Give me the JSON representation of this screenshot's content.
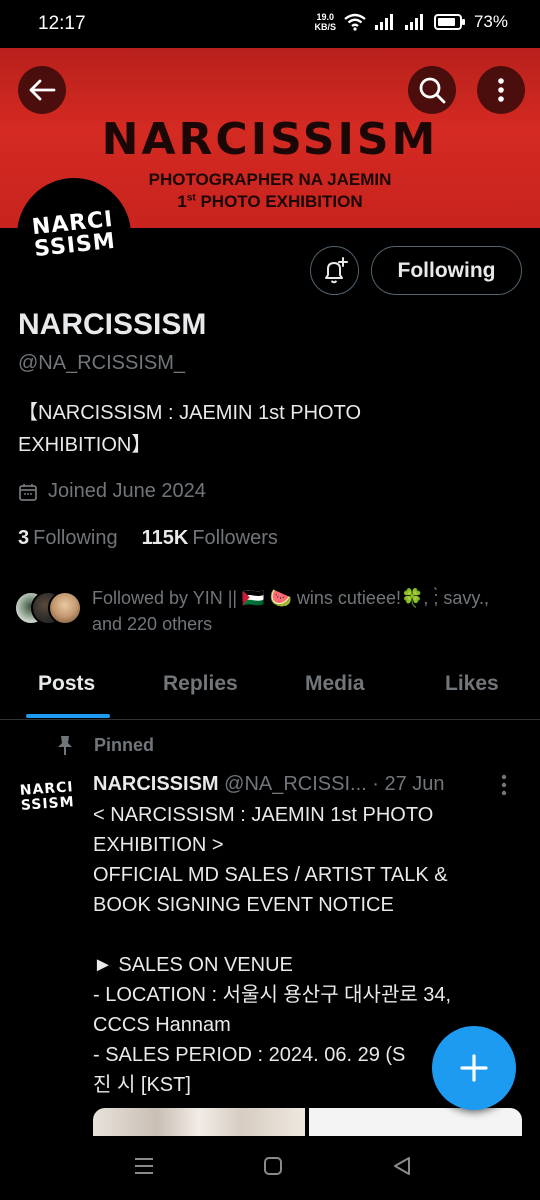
{
  "status": {
    "time": "12:17",
    "net_speed_value": "19.0",
    "net_speed_unit": "KB/S",
    "battery": "73%"
  },
  "banner": {
    "title": "NARCISSISM",
    "subtitle_line1": "PHOTOGRAPHER NA JAEMIN",
    "subtitle_line2_num": "1",
    "subtitle_line2_sup": "st",
    "subtitle_line2_rest": " PHOTO EXHIBITION"
  },
  "profile": {
    "avatar_text_line1": "NARCI",
    "avatar_text_line2": "SSISM",
    "following_button": "Following",
    "display_name": "NARCISSISM",
    "handle": "@NA_RCISSISM_",
    "bio": "【NARCISSISM : JAEMIN 1st PHOTO EXHIBITION】",
    "joined": "Joined June 2024",
    "following_count": "3",
    "following_label": "Following",
    "followers_count": "115K",
    "followers_label": "Followers",
    "followed_by": "Followed by YIN || 🇵🇸 🍉 wins cutieee!🍀, ;̀ savy., and 220 others"
  },
  "tabs": [
    {
      "label": "Posts"
    },
    {
      "label": "Replies"
    },
    {
      "label": "Media"
    },
    {
      "label": "Likes"
    }
  ],
  "post": {
    "pinned_label": "Pinned",
    "avatar_text_line1": "NARCI",
    "avatar_text_line2": "SSISM",
    "author_name": "NARCISSISM",
    "author_handle": " @NA_RCISSI...",
    "time": " · 27 Jun",
    "body": "< NARCISSISM : JAEMIN 1st PHOTO EXHIBITION >\nOFFICIAL MD SALES / ARTIST TALK & BOOK SIGNING EVENT NOTICE\n\n► SALES ON VENUE\n- LOCATION : 서울시 용산구 대사관로 34, CCCS Hannam\n- SALES PERIOD : 2024. 06. 29 (S          ~\n진 시 [KST]"
  },
  "icons": {
    "back": "arrow-left-icon",
    "search": "search-icon",
    "more": "more-vertical-icon",
    "bell": "bell-plus-icon",
    "calendar": "calendar-icon",
    "pin": "pin-icon",
    "compose": "plus-icon"
  },
  "colors": {
    "accent": "#1d9bf0",
    "banner_red": "#d42a22",
    "muted": "#71767b"
  }
}
